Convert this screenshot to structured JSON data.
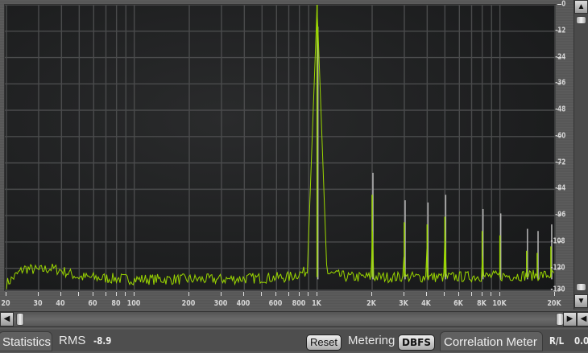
{
  "chart_data": {
    "type": "line",
    "x_scale": "log",
    "xlim": [
      20,
      20000
    ],
    "ylim": [
      -130,
      0
    ],
    "grid": true,
    "x_ticks": [
      {
        "v": 20,
        "label": "20"
      },
      {
        "v": 30,
        "label": "30"
      },
      {
        "v": 40,
        "label": "40"
      },
      {
        "v": 50,
        "label": ""
      },
      {
        "v": 60,
        "label": "60"
      },
      {
        "v": 70,
        "label": ""
      },
      {
        "v": 80,
        "label": "80"
      },
      {
        "v": 90,
        "label": ""
      },
      {
        "v": 100,
        "label": "100"
      },
      {
        "v": 200,
        "label": "200"
      },
      {
        "v": 300,
        "label": "300"
      },
      {
        "v": 400,
        "label": "400"
      },
      {
        "v": 500,
        "label": ""
      },
      {
        "v": 600,
        "label": "600"
      },
      {
        "v": 700,
        "label": ""
      },
      {
        "v": 800,
        "label": "800"
      },
      {
        "v": 900,
        "label": ""
      },
      {
        "v": 1000,
        "label": "1K"
      },
      {
        "v": 2000,
        "label": "2K"
      },
      {
        "v": 3000,
        "label": "3K"
      },
      {
        "v": 4000,
        "label": "4K"
      },
      {
        "v": 5000,
        "label": ""
      },
      {
        "v": 6000,
        "label": "6K"
      },
      {
        "v": 7000,
        "label": ""
      },
      {
        "v": 8000,
        "label": "8K"
      },
      {
        "v": 9000,
        "label": ""
      },
      {
        "v": 10000,
        "label": "10K"
      },
      {
        "v": 20000,
        "label": "20K"
      }
    ],
    "y_ticks": [
      {
        "v": 0,
        "label": "0"
      },
      {
        "v": -12,
        "label": "-12"
      },
      {
        "v": -24,
        "label": "-24"
      },
      {
        "v": -36,
        "label": "-36"
      },
      {
        "v": -48,
        "label": "-48"
      },
      {
        "v": -60,
        "label": "-60"
      },
      {
        "v": -72,
        "label": "-72"
      },
      {
        "v": -84,
        "label": "-84"
      },
      {
        "v": -96,
        "label": "-96"
      },
      {
        "v": -108,
        "label": "-108"
      },
      {
        "v": -120,
        "label": "-120"
      },
      {
        "v": -130,
        "label": "-130"
      }
    ],
    "noise_floor": [
      [
        20,
        -127
      ],
      [
        25,
        -120
      ],
      [
        30,
        -121
      ],
      [
        35,
        -120
      ],
      [
        40,
        -121
      ],
      [
        50,
        -124
      ],
      [
        100,
        -125
      ],
      [
        300,
        -125
      ],
      [
        700,
        -124
      ],
      [
        900,
        -121
      ],
      [
        1500,
        -124
      ],
      [
        5000,
        -124
      ],
      [
        20000,
        -123
      ]
    ],
    "peaks": [
      {
        "f": 1000,
        "db": 0
      },
      {
        "f": 2000,
        "db": -86.5
      },
      {
        "f": 3000,
        "db": -99
      },
      {
        "f": 4000,
        "db": -100
      },
      {
        "f": 5000,
        "db": -96.5
      },
      {
        "f": 8000,
        "db": -103
      },
      {
        "f": 10000,
        "db": -105
      },
      {
        "f": 14000,
        "db": -112
      },
      {
        "f": 16000,
        "db": -113
      },
      {
        "f": 19000,
        "db": -110
      }
    ],
    "line_color": "#9ad600",
    "peak_hold_color": "#b8b8b8"
  },
  "footer": {
    "statistics_tab": "Statistics",
    "rms_label": "RMS",
    "rms_value": "-8.9",
    "reset_button": "Reset",
    "metering_label": "Metering",
    "metering_value": "DBFS",
    "correlation_tab": "Correlation Meter",
    "rl_label": "R/L",
    "rl_value": "0.0"
  }
}
